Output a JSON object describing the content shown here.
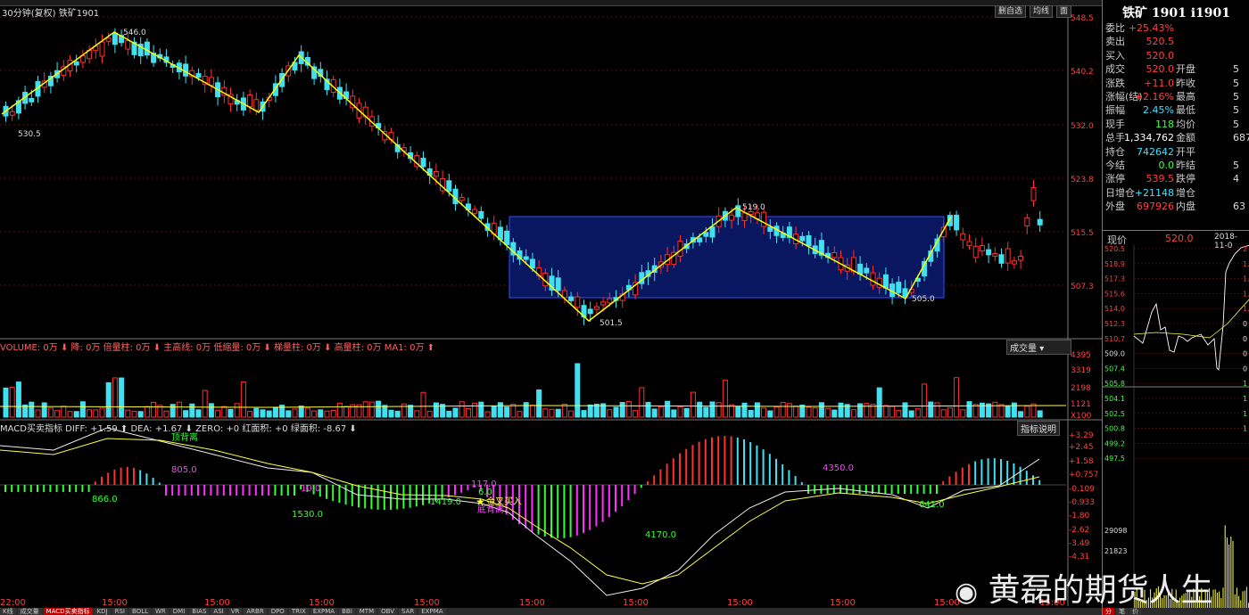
{
  "title_bar": {
    "period": "30分钟(复权)",
    "symbol": "铁矿1901"
  },
  "toolbar": {
    "buttons": [
      "删自选",
      "均线",
      "面"
    ]
  },
  "price_axis": [
    "548.5",
    "540.2",
    "532.0",
    "523.8",
    "515.5",
    "507.3"
  ],
  "price_labels": {
    "high": "546.0",
    "left": "530.5",
    "low": "501.5",
    "peak2": "519.0",
    "low2": "505.0"
  },
  "volume_header": {
    "text": "VOLUME: 0万 ⬇ 降: 0万 倍量柱: 0万 ⬇ 主高线: 0万 低缩量: 0万 ⬇ 梯量柱: 0万 ⬇ 高量柱: 0万 MA1: 0万 ⬆",
    "dropdown": "成交量"
  },
  "volume_axis": [
    "4395",
    "3319",
    "2198",
    "1121",
    "X100"
  ],
  "macd_header": {
    "text": "MACD买卖指标 DIFF: +1.59 ⬆ DEA: +1.67 ⬇ ZERO: +0 红面积: +0 绿面积: -8.67 ⬇",
    "button": "指标说明"
  },
  "macd_axis": [
    "+3.29",
    "+2.45",
    "+1.58",
    "+0.757",
    "-0.109",
    "-0.933",
    "-1.80",
    "-2.62",
    "-3.49",
    "-4.31"
  ],
  "macd_labels": {
    "top": "顶背离",
    "v805": "805.0",
    "v866": "866.0",
    "v10": "10.0",
    "v1530": "1530.0",
    "v1419": "1419.0",
    "v117": "117.0",
    "v6": "6.0",
    "buy": "金叉买入",
    "bottom": "底背离",
    "v4170": "4170.0",
    "v4350": "4350.0",
    "v641": "641.0"
  },
  "time_axis": [
    "22:00",
    "15:00",
    "15:00",
    "15:00",
    "15:00",
    "15:00",
    "15:00",
    "15:00",
    "15:00",
    "15:00",
    "15:00"
  ],
  "bottom_tabs": [
    "K线",
    "成交量",
    "MACD买卖指标",
    "KDJ",
    "RSI",
    "BOLL",
    "WR",
    "DMI",
    "BIAS",
    "ASI",
    "VR",
    "ARBR",
    "DPO",
    "TRIX",
    "EXPMA",
    "BBI",
    "MTM",
    "OBV",
    "SAR",
    "EXPMA"
  ],
  "right_panel": {
    "title": "铁矿 1901 i1901",
    "rows": [
      {
        "l1": "委比",
        "v1": "+25.43%",
        "c1": "red"
      },
      {
        "l1": "卖出",
        "v1": "520.5",
        "c1": "red"
      },
      {
        "l1": "买入",
        "v1": "520.0",
        "c1": "red"
      },
      {
        "l1": "成交",
        "v1": "520.0",
        "c1": "red",
        "l2": "开盘",
        "v2": "5"
      },
      {
        "l1": "涨跌",
        "v1": "+11.0",
        "c1": "red",
        "l2": "昨收",
        "v2": "5"
      },
      {
        "l1": "涨幅(结)",
        "v1": "+2.16%",
        "c1": "red",
        "l2": "最高",
        "v2": "5"
      },
      {
        "l1": "振幅",
        "v1": "2.45%",
        "c1": "cyan",
        "l2": "最低",
        "v2": "5"
      },
      {
        "l1": "现手",
        "v1": "118",
        "c1": "green",
        "l2": "均价",
        "v2": "5"
      },
      {
        "l1": "总手",
        "v1": "1,334,762",
        "c1": "white",
        "l2": "金额",
        "v2": "687"
      },
      {
        "l1": "持仓",
        "v1": "742642",
        "c1": "cyan",
        "l2": "开平",
        "v2": ""
      },
      {
        "l1": "今结",
        "v1": "0.0",
        "c1": "green",
        "l2": "昨结",
        "v2": "5"
      },
      {
        "l1": "涨停",
        "v1": "539.5",
        "c1": "red",
        "l2": "跌停",
        "v2": "4"
      },
      {
        "l1": "日增仓",
        "v1": "+21148",
        "c1": "cyan",
        "l2": "增仓",
        "v2": ""
      },
      {
        "l1": "外盘",
        "v1": "697926",
        "c1": "red",
        "l2": "内盘",
        "v2": "63"
      }
    ],
    "current": {
      "label": "现价",
      "value": "520.0",
      "date": "2018-11-0"
    },
    "mini_axis_left": [
      "520.5",
      "518.9",
      "517.3",
      "515.6",
      "514.0",
      "512.3",
      "510.7",
      "509.0",
      "507.4",
      "505.8",
      "504.1",
      "502.5",
      "500.8",
      "499.2",
      "497.5"
    ],
    "mini_axis_right": [
      "2",
      "1.5",
      "1.8",
      "1.4",
      "1.1",
      "0",
      "0",
      "0",
      "0",
      "1",
      "1",
      "1",
      "1"
    ],
    "mini_vol": [
      "29098",
      "21823"
    ],
    "mini_tabs": [
      "分",
      "笔",
      "价"
    ]
  },
  "watermark": "黄磊的期货人生",
  "colors": {
    "up": "#ff3030",
    "down": "#40e0f0",
    "box": "#1a2a8a",
    "zigzag": "#ffff00",
    "green_bar": "#30ff30",
    "magenta_bar": "#ff30ff"
  }
}
